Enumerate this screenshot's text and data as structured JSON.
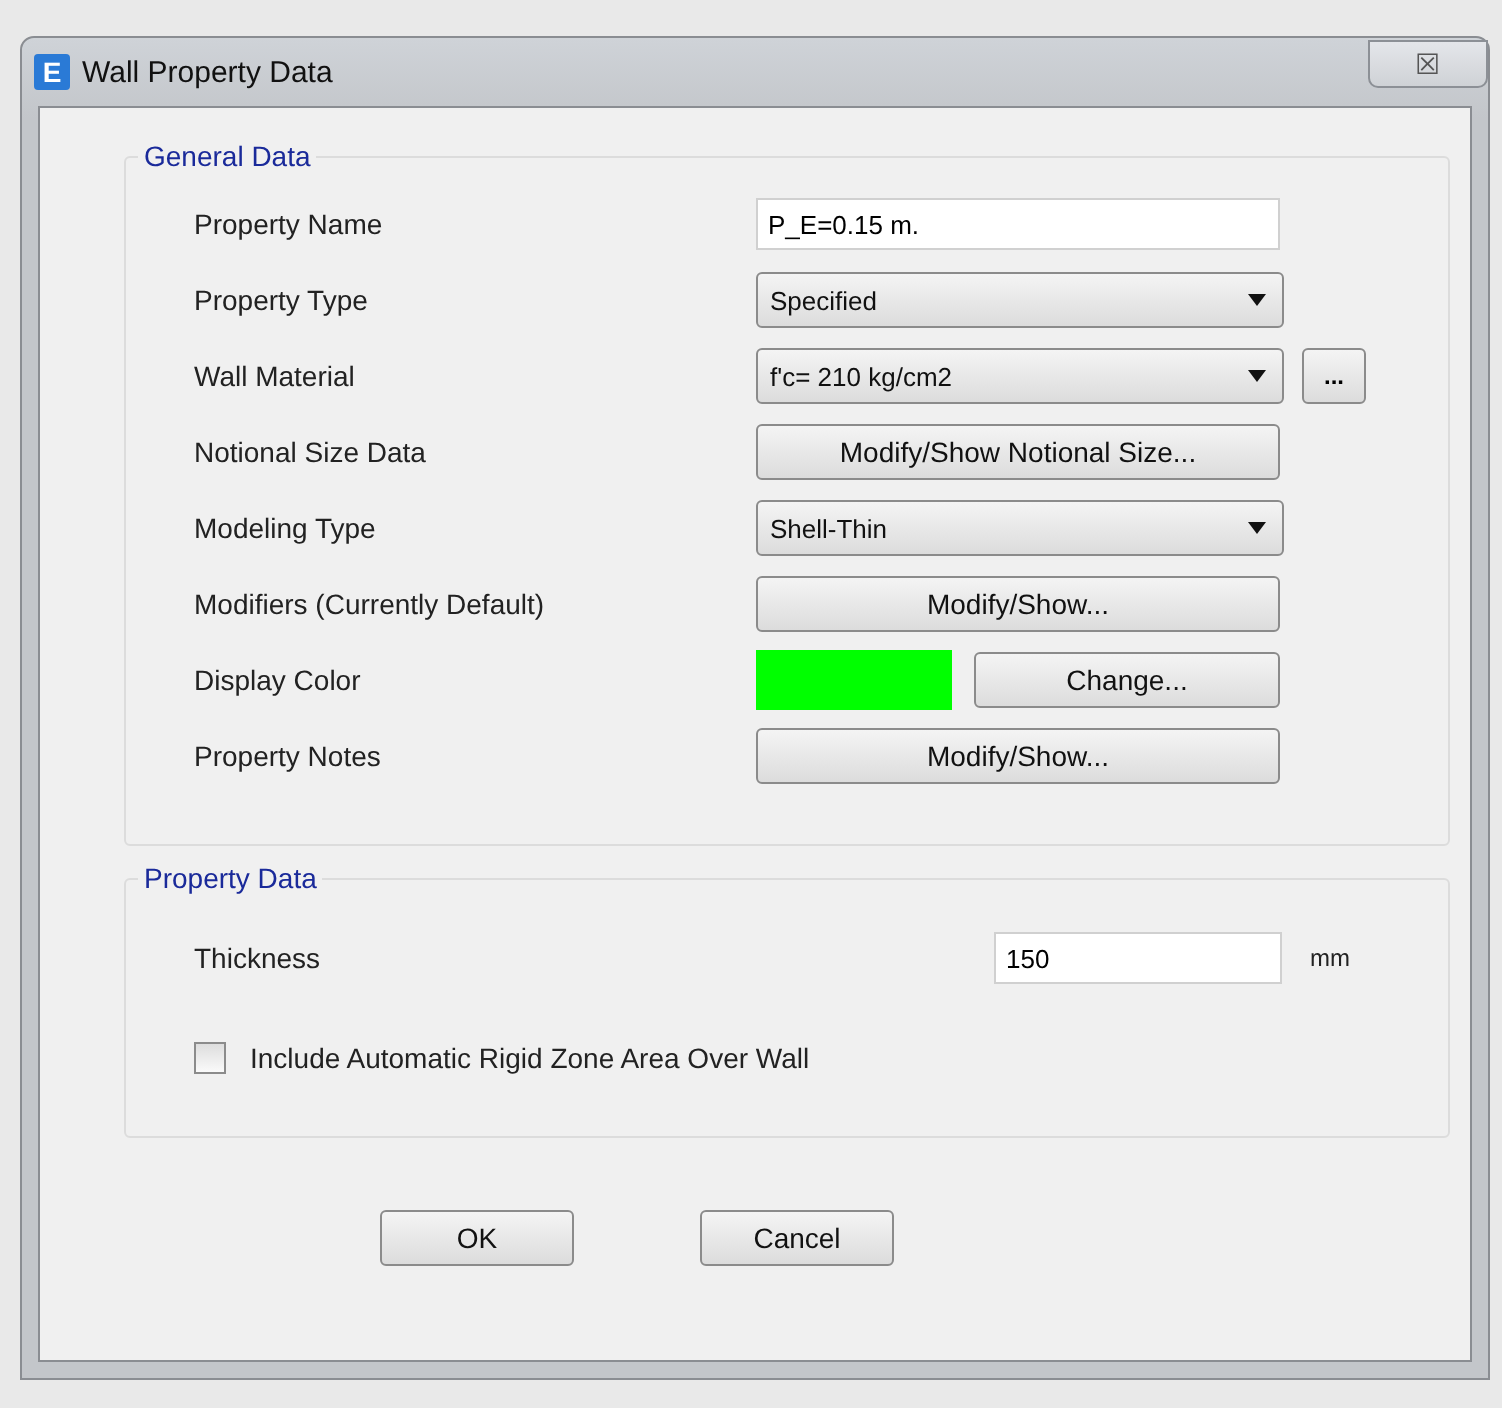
{
  "window": {
    "icon_letter": "E",
    "title": "Wall Property Data",
    "close": "☒"
  },
  "general_data": {
    "title": "General Data",
    "rows": [
      {
        "kind": "text",
        "label": "Property Name",
        "value": "P_E=0.15 m."
      },
      {
        "kind": "dropdown",
        "label": "Property Type",
        "value": "Specified"
      },
      {
        "kind": "dropdown",
        "label": "Wall Material",
        "value": "f'c= 210 kg/cm2",
        "extra_button": "..."
      },
      {
        "kind": "button",
        "label": "Notional Size Data",
        "button": "Modify/Show Notional Size..."
      },
      {
        "kind": "dropdown",
        "label": "Modeling Type",
        "value": "Shell-Thin"
      },
      {
        "kind": "button",
        "label": "Modifiers (Currently Default)",
        "button": "Modify/Show..."
      },
      {
        "kind": "color",
        "label": "Display Color",
        "color": "#00ff00",
        "button": "Change..."
      },
      {
        "kind": "button",
        "label": "Property Notes",
        "button": "Modify/Show..."
      }
    ]
  },
  "property_data": {
    "title": "Property Data",
    "thickness": {
      "label": "Thickness",
      "value": "150",
      "unit": "mm"
    },
    "rigid_zone": {
      "label": "Include Automatic Rigid Zone Area Over Wall",
      "checked": false
    }
  },
  "buttons": [
    "OK",
    "Cancel"
  ]
}
